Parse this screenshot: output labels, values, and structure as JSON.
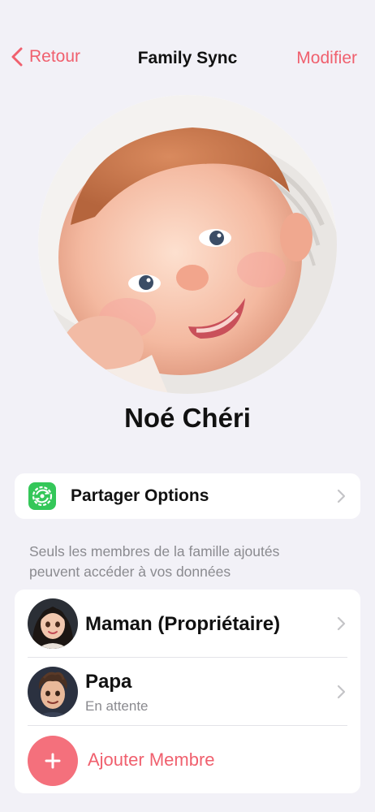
{
  "nav": {
    "back_label": "Retour",
    "title": "Family Sync",
    "edit_label": "Modifier"
  },
  "profile": {
    "name": "Noé Chéri"
  },
  "share": {
    "label": "Partager Options"
  },
  "info": {
    "text": "Seuls les membres de la famille ajoutés peuvent accéder à vos données"
  },
  "members": [
    {
      "name": "Maman (Propriétaire)",
      "status": ""
    },
    {
      "name": "Papa",
      "status": "En attente"
    }
  ],
  "add_member": {
    "label": "Ajouter Membre"
  },
  "colors": {
    "accent": "#f0606e",
    "share_icon_bg": "#34c759",
    "background": "#f2f1f7"
  }
}
